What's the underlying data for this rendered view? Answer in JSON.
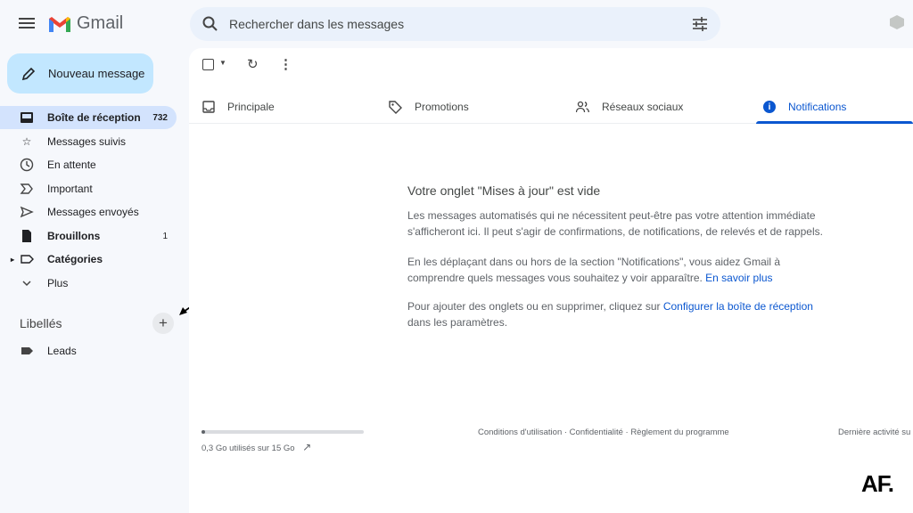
{
  "header": {
    "app_name": "Gmail",
    "search_placeholder": "Rechercher dans les messages"
  },
  "sidebar": {
    "compose_label": "Nouveau message",
    "items": [
      {
        "label": "Boîte de réception",
        "count": "732"
      },
      {
        "label": "Messages suivis"
      },
      {
        "label": "En attente"
      },
      {
        "label": "Important"
      },
      {
        "label": "Messages envoyés"
      },
      {
        "label": "Brouillons",
        "count": "1"
      },
      {
        "label": "Catégories"
      },
      {
        "label": "Plus"
      }
    ],
    "labels_title": "Libellés",
    "labels": [
      {
        "label": "Leads"
      }
    ]
  },
  "tabs": [
    {
      "label": "Principale"
    },
    {
      "label": "Promotions"
    },
    {
      "label": "Réseaux sociaux"
    },
    {
      "label": "Notifications",
      "selected": true
    }
  ],
  "empty_state": {
    "title": "Votre onglet \"Mises à jour\" est vide",
    "p1": "Les messages automatisés qui ne nécessitent peut-être pas votre attention immédiate s'afficheront ici. Il peut s'agir de confirmations, de notifications, de relevés et de rappels.",
    "p2": "En les déplaçant dans ou hors de la section \"Notifications\", vous aidez Gmail à comprendre quels messages vous souhaitez y voir apparaître. ",
    "p2_link": "En savoir plus",
    "p3": "Pour ajouter des onglets ou en supprimer, cliquez sur ",
    "p3_link": "Configurer la boîte de réception",
    "p3_end": " dans les paramètres."
  },
  "footer": {
    "storage_text": "0,3 Go utilisés sur 15 Go",
    "storage_used_percent": 2,
    "links": "Conditions d'utilisation · Confidentialité · Règlement du programme",
    "last_activity": "Dernière activité su"
  },
  "watermark": "AF.",
  "colors": {
    "accent": "#0b57d0",
    "compose": "#c2e7ff",
    "active_nav": "#d3e3fd"
  }
}
